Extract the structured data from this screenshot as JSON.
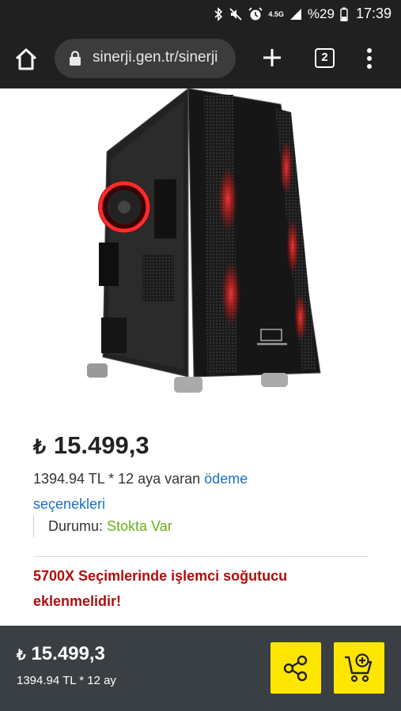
{
  "status_bar": {
    "network": "4.5G",
    "battery": "%29",
    "time": "17:39"
  },
  "browser": {
    "url": "sinerji.gen.tr/sinerji",
    "tab_count": "2"
  },
  "product": {
    "currency_symbol": "₺",
    "price": "15.499,3",
    "installment_text": "1394.94 TL * 12 aya varan ",
    "installment_link": "ödeme seçenekleri",
    "stock_label": "Durumu: ",
    "stock_value": "Stokta Var",
    "notice": "5700X Seçimlerinde işlemci soğutucu eklenmelidir!"
  },
  "bottom_bar": {
    "currency_symbol": "₺",
    "price": "15.499,3",
    "installment": "1394.94 TL * 12 ay"
  },
  "colors": {
    "link": "#1a6fc9",
    "in_stock": "#69b21b",
    "notice": "#b10d0d",
    "action_button": "#ffe600",
    "bottom_bar": "#3a3f44"
  }
}
